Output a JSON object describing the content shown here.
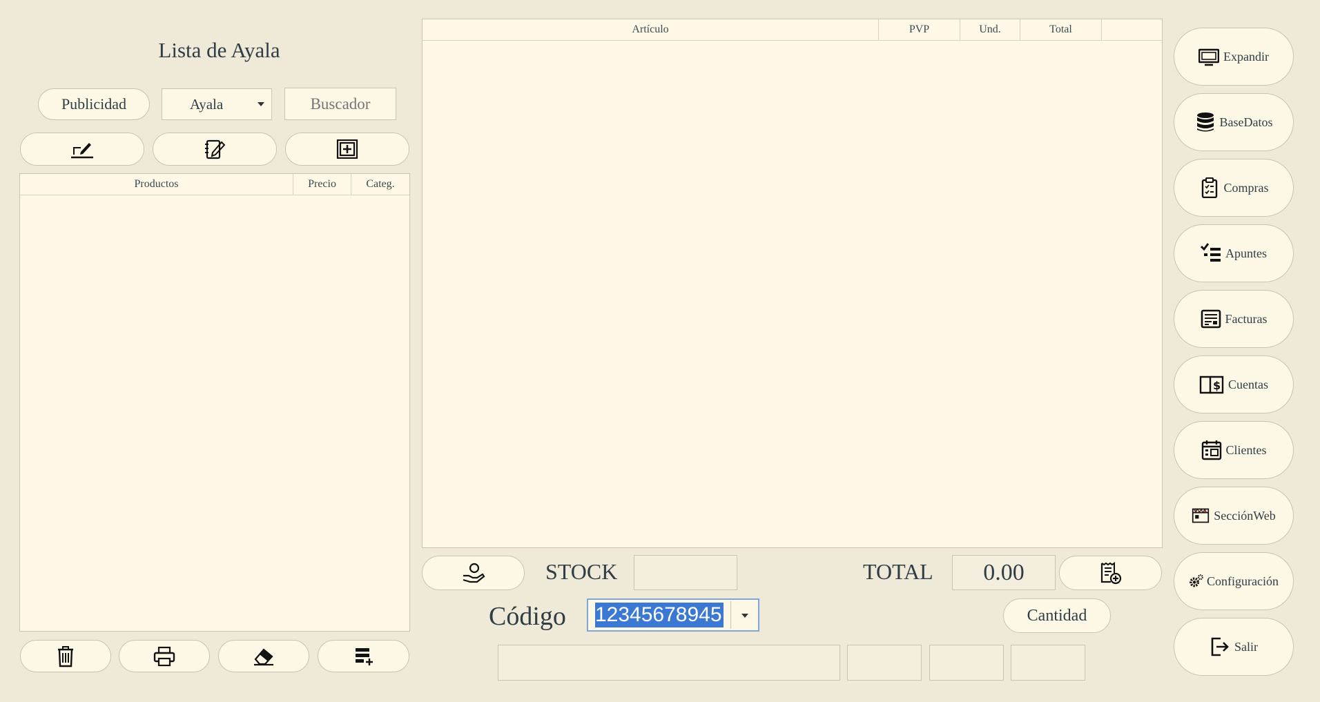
{
  "left": {
    "title": "Lista de Ayala",
    "publicidad_label": "Publicidad",
    "list_select": "Ayala",
    "search_placeholder": "Buscador",
    "columns": [
      "Productos",
      "Precio",
      "Categ."
    ]
  },
  "ticket": {
    "columns": [
      "Artículo",
      "PVP",
      "Und.",
      "Total"
    ]
  },
  "bottom": {
    "stock_label": "STOCK",
    "stock_value": "",
    "total_label": "TOTAL",
    "total_value": "0.00",
    "codigo_label": "Código",
    "codigo_value": "12345678945",
    "cantidad_label": "Cantidad"
  },
  "sidebar": {
    "items": [
      {
        "label": "Expandir",
        "icon": "monitor-icon"
      },
      {
        "label": "BaseDatos",
        "icon": "database-icon"
      },
      {
        "label": "Compras",
        "icon": "clipboard-icon"
      },
      {
        "label": "Apuntes",
        "icon": "checklist-icon"
      },
      {
        "label": "Facturas",
        "icon": "invoice-icon"
      },
      {
        "label": "Cuentas",
        "icon": "ledger-icon"
      },
      {
        "label": "Clientes",
        "icon": "calendar-icon"
      },
      {
        "label": "SecciónWeb",
        "icon": "web-section-icon"
      },
      {
        "label": "Configuración",
        "icon": "gears-icon"
      },
      {
        "label": "Salir",
        "icon": "exit-icon"
      }
    ]
  },
  "colors": {
    "background": "#efe9d8",
    "panel": "#fff8e6",
    "text": "#2f3e46",
    "selection": "#3a78d4"
  }
}
